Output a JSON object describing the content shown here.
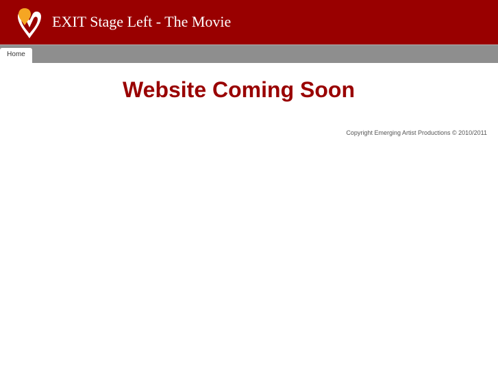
{
  "header": {
    "logo_icon": "heart-location-pin-logo-icon",
    "title": "EXIT Stage Left - The Movie",
    "background_color": "#990000",
    "logo_colors": {
      "pin": "#f5a623",
      "heart": "#ffffff"
    }
  },
  "nav": {
    "tabs": [
      {
        "label": "Home",
        "active": true
      }
    ],
    "bar_color": "#8e8e8e"
  },
  "main": {
    "headline": "Website Coming Soon",
    "headline_color": "#990000"
  },
  "footer": {
    "copyright": "Copyright Emerging Artist Productions © 2010/2011"
  }
}
